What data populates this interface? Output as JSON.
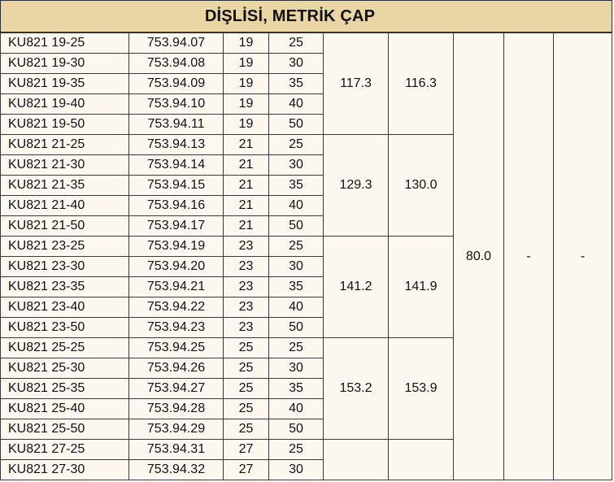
{
  "title": "DİŞLİSİ, METRİK ÇAP",
  "groups": [
    {
      "rows": [
        {
          "code": "KU821 19-25",
          "ref": "753.94.07",
          "d": "19",
          "l": "25"
        },
        {
          "code": "KU821 19-30",
          "ref": "753.94.08",
          "d": "19",
          "l": "30"
        },
        {
          "code": "KU821 19-35",
          "ref": "753.94.09",
          "d": "19",
          "l": "35"
        },
        {
          "code": "KU821 19-40",
          "ref": "753.94.10",
          "d": "19",
          "l": "40"
        },
        {
          "code": "KU821 19-50",
          "ref": "753.94.11",
          "d": "19",
          "l": "50"
        }
      ],
      "value_a": "117.3",
      "value_b": "116.3"
    },
    {
      "rows": [
        {
          "code": "KU821 21-25",
          "ref": "753.94.13",
          "d": "21",
          "l": "25"
        },
        {
          "code": "KU821 21-30",
          "ref": "753.94.14",
          "d": "21",
          "l": "30"
        },
        {
          "code": "KU821 21-35",
          "ref": "753.94.15",
          "d": "21",
          "l": "35"
        },
        {
          "code": "KU821 21-40",
          "ref": "753.94.16",
          "d": "21",
          "l": "40"
        },
        {
          "code": "KU821 21-50",
          "ref": "753.94.17",
          "d": "21",
          "l": "50"
        }
      ],
      "value_a": "129.3",
      "value_b": "130.0"
    },
    {
      "rows": [
        {
          "code": "KU821 23-25",
          "ref": "753.94.19",
          "d": "23",
          "l": "25"
        },
        {
          "code": "KU821 23-30",
          "ref": "753.94.20",
          "d": "23",
          "l": "30"
        },
        {
          "code": "KU821 23-35",
          "ref": "753.94.21",
          "d": "23",
          "l": "35"
        },
        {
          "code": "KU821 23-40",
          "ref": "753.94.22",
          "d": "23",
          "l": "40"
        },
        {
          "code": "KU821 23-50",
          "ref": "753.94.23",
          "d": "23",
          "l": "50"
        }
      ],
      "value_a": "141.2",
      "value_b": "141.9"
    },
    {
      "rows": [
        {
          "code": "KU821 25-25",
          "ref": "753.94.25",
          "d": "25",
          "l": "25"
        },
        {
          "code": "KU821 25-30",
          "ref": "753.94.26",
          "d": "25",
          "l": "30"
        },
        {
          "code": "KU821 25-35",
          "ref": "753.94.27",
          "d": "25",
          "l": "35"
        },
        {
          "code": "KU821 25-40",
          "ref": "753.94.28",
          "d": "25",
          "l": "40"
        },
        {
          "code": "KU821 25-50",
          "ref": "753.94.29",
          "d": "25",
          "l": "50"
        }
      ],
      "value_a": "153.2",
      "value_b": "153.9"
    },
    {
      "rows": [
        {
          "code": "KU821 27-25",
          "ref": "753.94.31",
          "d": "27",
          "l": "25"
        },
        {
          "code": "KU821 27-30",
          "ref": "753.94.32",
          "d": "27",
          "l": "30"
        }
      ],
      "value_a": "",
      "value_b": ""
    }
  ],
  "shared": {
    "value_c": "80.0",
    "value_d": "-",
    "value_e": "-"
  }
}
